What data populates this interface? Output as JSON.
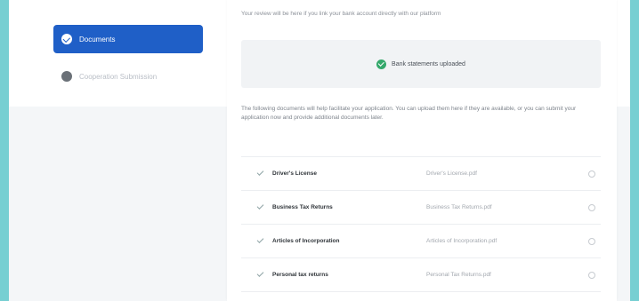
{
  "sidebar": {
    "items": [
      {
        "label": "Documents",
        "icon": "check-icon",
        "active": true
      },
      {
        "label": "Cooperation Submission",
        "icon": "dot-icon",
        "active": false
      }
    ]
  },
  "main": {
    "intro": "Your review will be here if you link your bank account directly with our platform",
    "banner": {
      "icon": "check-circle-icon",
      "text": "Bank statements uploaded"
    },
    "description": "The following documents will help facilitate your application. You can upload them here if they are available, or you can submit your application now and provide additional documents later.",
    "documents": [
      {
        "name": "Driver's License",
        "file": "Driver's License.pdf",
        "action_icon": "remove-icon"
      },
      {
        "name": "Business Tax Returns",
        "file": "Business Tax Returns.pdf",
        "action_icon": "remove-icon"
      },
      {
        "name": "Articles of Incorporation",
        "file": "Articles of Incorporation.pdf",
        "action_icon": "remove-icon"
      },
      {
        "name": "Personal tax returns",
        "file": "Personal Tax Returns.pdf",
        "action_icon": "remove-icon"
      }
    ]
  },
  "colors": {
    "frame": "#77cfd2",
    "accent": "#1f5fc7",
    "success": "#34a86b"
  }
}
